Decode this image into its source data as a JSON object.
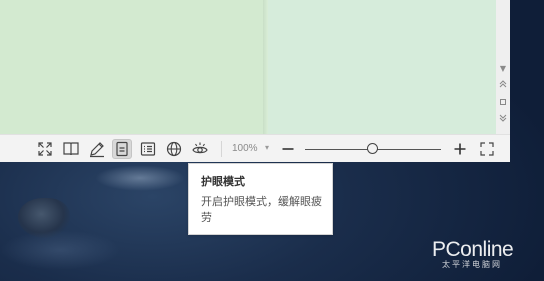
{
  "toolbar": {
    "zoom_value": "100%",
    "zoom_level": 0.5,
    "icons": [
      "fullscreen-icon",
      "book-icon",
      "pen-icon",
      "document-icon",
      "list-icon",
      "globe-icon",
      "eye-care-icon"
    ],
    "active_icon": "eye-care-icon"
  },
  "tooltip": {
    "title": "护眼模式",
    "body": "开启护眼模式，缓解眼疲劳"
  },
  "watermark": {
    "brand": "PConline",
    "sub": "太平洋电脑网"
  },
  "colors": {
    "eye_care_page": "#d3ead0",
    "toolbar": "#f3f3f3"
  }
}
